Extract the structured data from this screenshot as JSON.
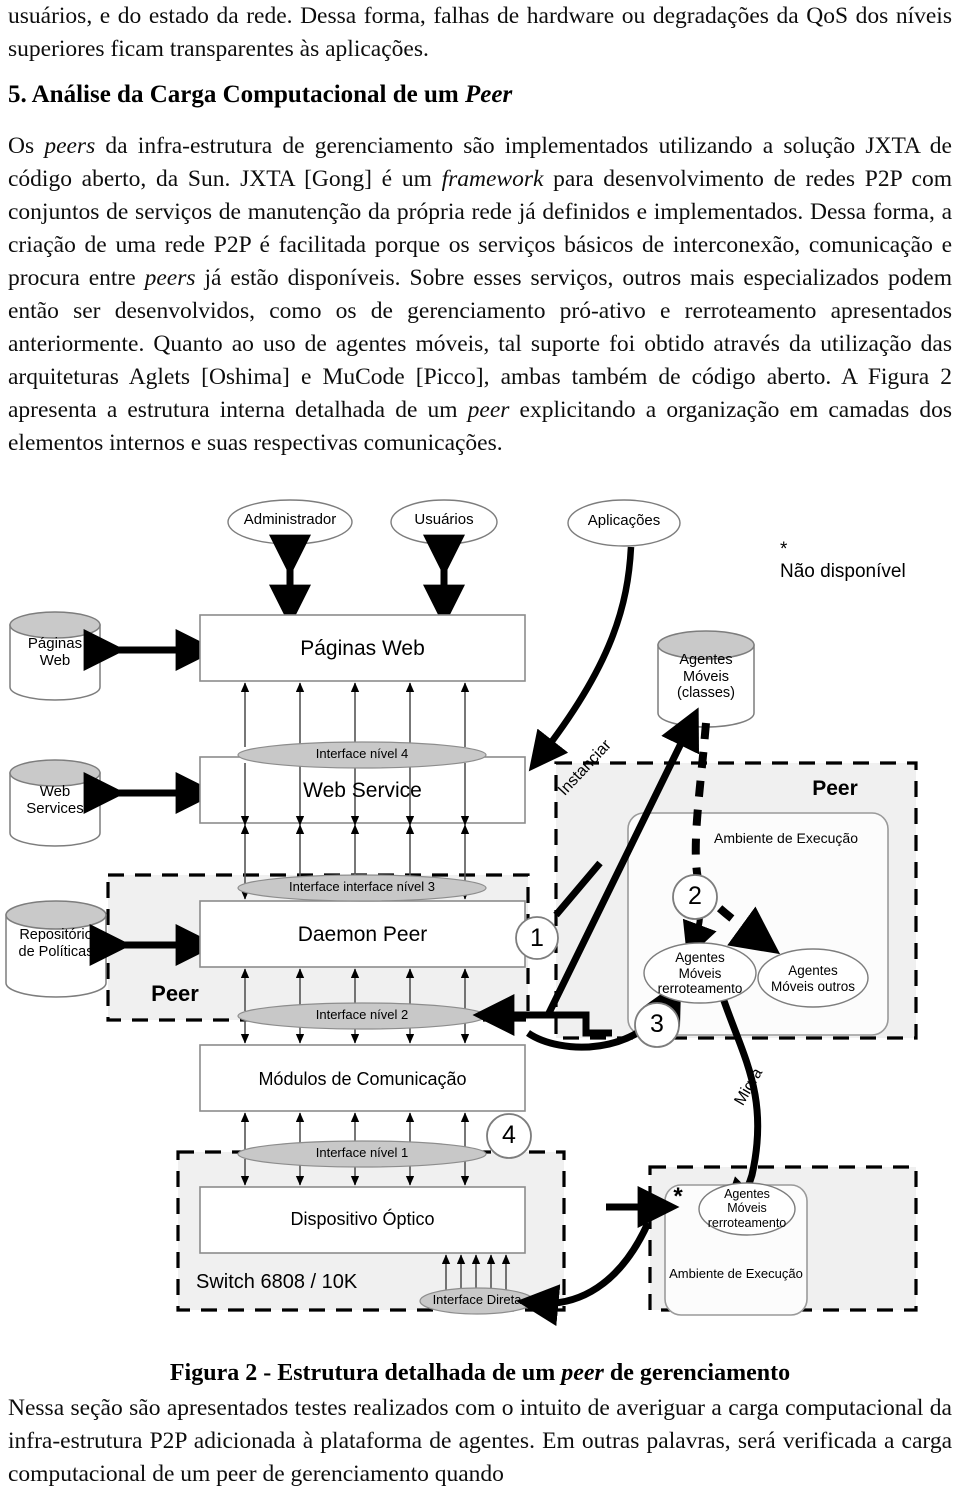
{
  "document": {
    "paragraph_top": "usuários, e do estado da rede. Dessa forma, falhas de hardware ou degradações da QoS dos níveis superiores ficam transparentes às aplicações.",
    "section_number": "5.",
    "section_title_plain": "Análise da Carga Computacional de um ",
    "section_title_italic": "Peer",
    "paragraph_body_1": "Os ",
    "paragraph_body_i1": "peers",
    "paragraph_body_2": " da infra-estrutura de gerenciamento são implementados utilizando a solução JXTA de código aberto, da Sun. JXTA [Gong] é um ",
    "paragraph_body_i2": "framework",
    "paragraph_body_3": " para desenvolvimento de redes P2P com conjuntos de serviços de manutenção da própria rede já definidos e implementados. Dessa forma, a criação de uma rede P2P é facilitada porque os serviços básicos de interconexão, comunicação e procura entre ",
    "paragraph_body_i3": "peers",
    "paragraph_body_4": " já estão disponíveis. Sobre esses serviços, outros mais especializados podem então ser desenvolvidos, como os de gerenciamento pró-ativo e rerroteamento apresentados anteriormente. Quanto ao uso de agentes móveis, tal suporte foi obtido através da utilização das arquiteturas Aglets [Oshima] e MuCode [Picco], ambas também de código aberto. A Figura 2 apresenta a estrutura interna detalhada de um ",
    "paragraph_body_i4": "peer",
    "paragraph_body_5": " explicitando a organização em camadas dos elementos internos e suas respectivas comunicações.",
    "figure_caption_1": "Figura 2 - Estrutura detalhada de um ",
    "figure_caption_i": "peer",
    "figure_caption_2": " de gerenciamento",
    "paragraph_bottom": "Nessa seção são apresentados testes realizados com o intuito de averiguar a carga computacional da infra-estrutura P2P adicionada à plataforma de agentes. Em outras palavras, será verificada a carga computacional de um peer de gerenciamento quando",
    "paragraph_bottom_i": "peer"
  },
  "figure": {
    "actors": [
      {
        "id": "administrador",
        "label": "Administrador"
      },
      {
        "id": "usuarios",
        "label": "Usuários"
      },
      {
        "id": "aplicacoes",
        "label": "Aplicações"
      }
    ],
    "legend": {
      "marker": "*",
      "text": "Não disponível"
    },
    "datastores": [
      {
        "id": "paginas-web-store",
        "label": "Páginas\nWeb"
      },
      {
        "id": "web-services-store",
        "label": "Web\nServices"
      },
      {
        "id": "repositorio-politicas-store",
        "label": "Repositório\nde Políticas"
      },
      {
        "id": "agentes-moveis-classes-store",
        "label": "Agentes\nMóveis\n(classes)"
      }
    ],
    "layers": [
      {
        "id": "paginas-web-layer",
        "label": "Páginas Web"
      },
      {
        "id": "web-service-layer",
        "label": "Web Service"
      },
      {
        "id": "daemon-peer-layer",
        "label": "Daemon Peer"
      },
      {
        "id": "modulos-comunicacao-layer",
        "label": "Módulos de Comunicação"
      },
      {
        "id": "dispositivo-optico-layer",
        "label": "Dispositivo Óptico"
      }
    ],
    "interfaces": [
      {
        "id": "interface-nivel-4",
        "label": "Interface nível 4"
      },
      {
        "id": "interface-nivel-3",
        "label": "Interface interface nível 3"
      },
      {
        "id": "interface-nivel-2",
        "label": "Interface nível 2"
      },
      {
        "id": "interface-nivel-1",
        "label": "Interface nível 1"
      },
      {
        "id": "interface-direta",
        "label": "Interface Direta"
      }
    ],
    "peer_label_left": "Peer",
    "peer_label_right": "Peer",
    "switch_label": "Switch 6808 / 10K",
    "execution_env_top": "Ambiente de Execução",
    "execution_env_bottom": "Ambiente de Execução",
    "agent_top": "Agentes\nMóveis\nrerroteamento",
    "agent_other": "Agentes\nMóveis  outros",
    "agent_bottom": "Agentes\nMóveis\nrerroteamento",
    "unavailable_marker": "*",
    "edge_labels": [
      {
        "id": "instanciar",
        "label": "Instanciar"
      },
      {
        "id": "migra",
        "label": "Migra"
      }
    ],
    "step_markers": [
      {
        "id": "step-1",
        "label": "1"
      },
      {
        "id": "step-2",
        "label": "2"
      },
      {
        "id": "step-3",
        "label": "3"
      },
      {
        "id": "step-4",
        "label": "4"
      }
    ],
    "colors": {
      "cylinder_top": "#c9c9c9",
      "interface_fill": "#c8c8c8",
      "peer_region_fill": "#f0f0f0",
      "box_stroke": "#8c8c8c",
      "dashed_stroke": "#000000"
    }
  }
}
